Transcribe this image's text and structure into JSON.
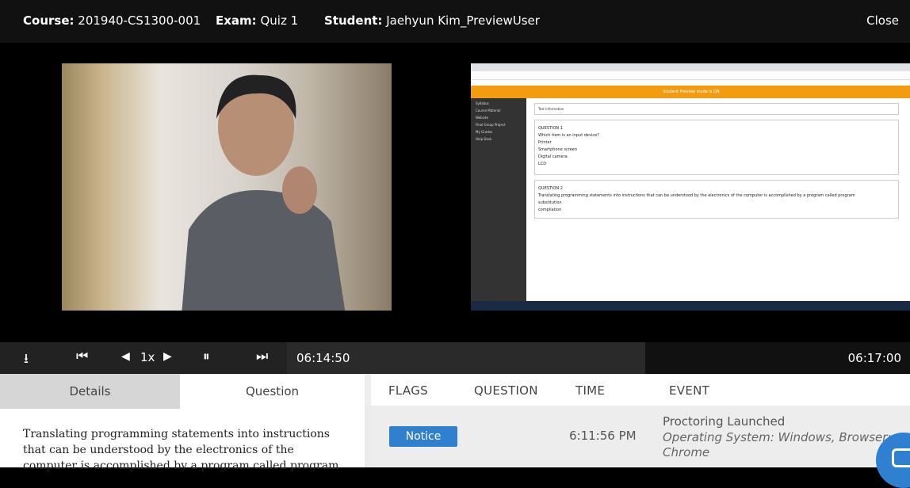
{
  "header": {
    "course_label": "Course:",
    "course_value": "201940-CS1300-001",
    "exam_label": "Exam:",
    "exam_value": "Quiz 1",
    "student_label": "Student:",
    "student_value": "Jaehyun Kim_PreviewUser",
    "close_label": "Close"
  },
  "playback": {
    "speed": "1x",
    "current_time": "06:14:50",
    "end_time": "06:17:00"
  },
  "screen_capture": {
    "preview_banner": "Student Preview mode is ON",
    "sidebar": [
      "Syllabus",
      "Course Material",
      "Website",
      "Final Group Project",
      "My Grades",
      "Help Desk"
    ],
    "test_info": "Test Information",
    "question1_title": "QUESTION 1",
    "question1_text": "Which item is an input device?",
    "question1_options": [
      "Printer",
      "Smartphone screen",
      "Digital camera",
      "LCD"
    ],
    "question2_title": "QUESTION 2",
    "question2_text": "Translating programming statements into instructions that can be understood by the electronics of the computer is accomplished by a program called program",
    "question2_options": [
      "substitution",
      "compilation"
    ]
  },
  "tabs": {
    "details": "Details",
    "question": "Question"
  },
  "question_text": "Translating programming statements into instructions that can be understood by the electronics of the computer is accomplished by a program called program",
  "table": {
    "headers": {
      "flags": "FLAGS",
      "question": "QUESTION",
      "time": "TIME",
      "event": "EVENT"
    },
    "rows": [
      {
        "flag": "Notice",
        "question": "",
        "time": "6:11:56 PM",
        "event_title": "Proctoring Launched",
        "event_detail": "Operating System: Windows, Browser: Chrome"
      }
    ]
  }
}
